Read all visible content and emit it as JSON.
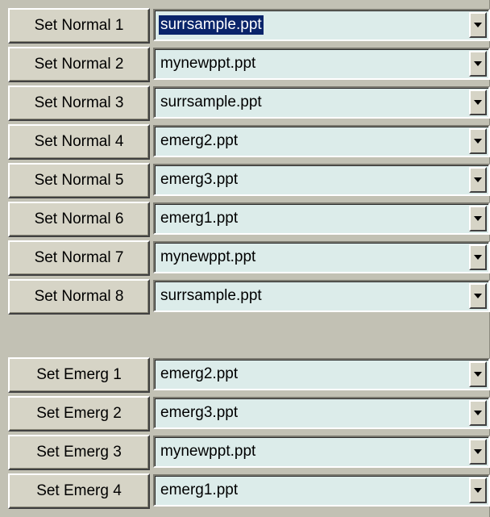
{
  "normal": [
    {
      "button": "Set Normal 1",
      "value": "surrsample.ppt",
      "selected": true
    },
    {
      "button": "Set Normal 2",
      "value": "mynewppt.ppt"
    },
    {
      "button": "Set Normal 3",
      "value": "surrsample.ppt"
    },
    {
      "button": "Set Normal 4",
      "value": "emerg2.ppt"
    },
    {
      "button": "Set Normal 5",
      "value": "emerg3.ppt"
    },
    {
      "button": "Set Normal 6",
      "value": "emerg1.ppt"
    },
    {
      "button": "Set Normal 7",
      "value": "mynewppt.ppt"
    },
    {
      "button": "Set Normal 8",
      "value": "surrsample.ppt"
    }
  ],
  "emerg": [
    {
      "button": "Set Emerg 1",
      "value": "emerg2.ppt"
    },
    {
      "button": "Set Emerg 2",
      "value": "emerg3.ppt"
    },
    {
      "button": "Set Emerg 3",
      "value": "mynewppt.ppt"
    },
    {
      "button": "Set Emerg 4",
      "value": "emerg1.ppt"
    }
  ],
  "icons": {
    "dropdown": "chevron-down-icon"
  },
  "colors": {
    "combo_bg": "#dcecea",
    "selection": "#0a246a",
    "panel_bg": "#c2c1b4"
  }
}
